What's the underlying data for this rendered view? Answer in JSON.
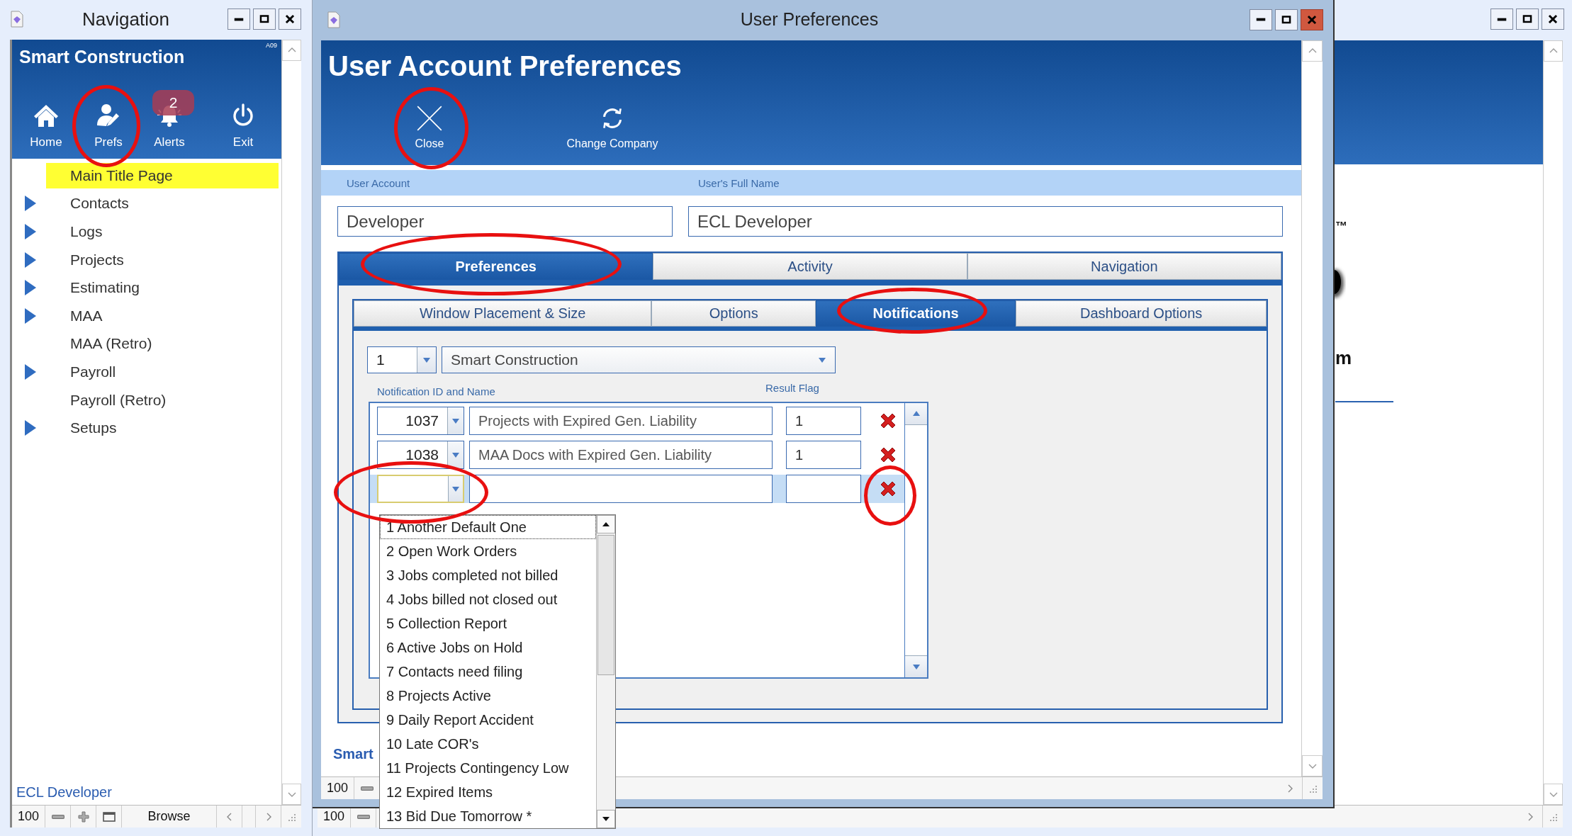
{
  "navigation_window": {
    "title": "Navigation",
    "app_name": "Smart Construction",
    "version_tag": "A09",
    "toolbar": [
      {
        "kind": "home",
        "label": "Home"
      },
      {
        "kind": "prefs",
        "label": "Prefs"
      },
      {
        "kind": "alerts",
        "label": "Alerts",
        "badge": "2"
      },
      {
        "kind": "exit",
        "label": "Exit"
      }
    ],
    "menu": [
      {
        "label": "Main Title Page",
        "selected": true,
        "expandable": false
      },
      {
        "label": "Contacts",
        "selected": false,
        "expandable": true
      },
      {
        "label": "Logs",
        "selected": false,
        "expandable": true
      },
      {
        "label": "Projects",
        "selected": false,
        "expandable": true
      },
      {
        "label": "Estimating",
        "selected": false,
        "expandable": true
      },
      {
        "label": "MAA",
        "selected": false,
        "expandable": true
      },
      {
        "label": "MAA (Retro)",
        "selected": false,
        "expandable": false
      },
      {
        "label": "Payroll",
        "selected": false,
        "expandable": true
      },
      {
        "label": "Payroll (Retro)",
        "selected": false,
        "expandable": false
      },
      {
        "label": "Setups",
        "selected": false,
        "expandable": true
      }
    ],
    "user": "ECL Developer",
    "status_bar": {
      "zoom": "100",
      "mode": "Browse"
    }
  },
  "background_window": {
    "trademark": "™",
    "text_fragment": "m",
    "status_bar": {
      "zoom": "100"
    }
  },
  "preferences_window": {
    "title": "User Preferences",
    "heading": "User Account Preferences",
    "toolbar": [
      {
        "kind": "close",
        "label": "Close"
      },
      {
        "kind": "refresh",
        "label": "Change Company"
      }
    ],
    "fields": [
      {
        "label": "User Account",
        "value": "Developer"
      },
      {
        "label": "User's Full Name",
        "value": "ECL Developer"
      }
    ],
    "tabs": [
      {
        "label": "Preferences",
        "selected": true
      },
      {
        "label": "Activity",
        "selected": false
      },
      {
        "label": "Navigation",
        "selected": false
      }
    ],
    "subtabs": [
      {
        "label": "Window Placement & Size",
        "selected": false
      },
      {
        "label": "Options",
        "selected": false
      },
      {
        "label": "Notifications",
        "selected": true
      },
      {
        "label": "Dashboard Options",
        "selected": false
      }
    ],
    "company": {
      "number": "1",
      "name": "Smart Construction"
    },
    "columns": [
      "Notification ID and Name",
      "Result Flag"
    ],
    "rows": [
      {
        "id": "1037",
        "name": "Projects with Expired Gen. Liability",
        "flag": "1",
        "selected": false
      },
      {
        "id": "1038",
        "name": "MAA Docs with Expired Gen. Liability",
        "flag": "1",
        "selected": false
      },
      {
        "id": "",
        "name": "",
        "flag": "",
        "selected": true
      }
    ],
    "dropdown": [
      {
        "label": "1 Another Default One",
        "selected": true
      },
      {
        "label": "2 Open Work Orders",
        "selected": false
      },
      {
        "label": "3 Jobs completed not billed",
        "selected": false
      },
      {
        "label": "4 Jobs billed not closed out",
        "selected": false
      },
      {
        "label": "5 Collection Report",
        "selected": false
      },
      {
        "label": "6 Active Jobs on Hold",
        "selected": false
      },
      {
        "label": "7 Contacts need filing",
        "selected": false
      },
      {
        "label": "8 Projects Active",
        "selected": false
      },
      {
        "label": "9 Daily Report Accident",
        "selected": false
      },
      {
        "label": "10 Late COR's",
        "selected": false
      },
      {
        "label": "11 Projects Contingency Low",
        "selected": false
      },
      {
        "label": "12 Expired Items",
        "selected": false
      },
      {
        "label": "13 Bid Due Tomorrow *",
        "selected": false
      }
    ],
    "footer_text": "Smart",
    "status_bar": {
      "zoom": "100"
    }
  }
}
